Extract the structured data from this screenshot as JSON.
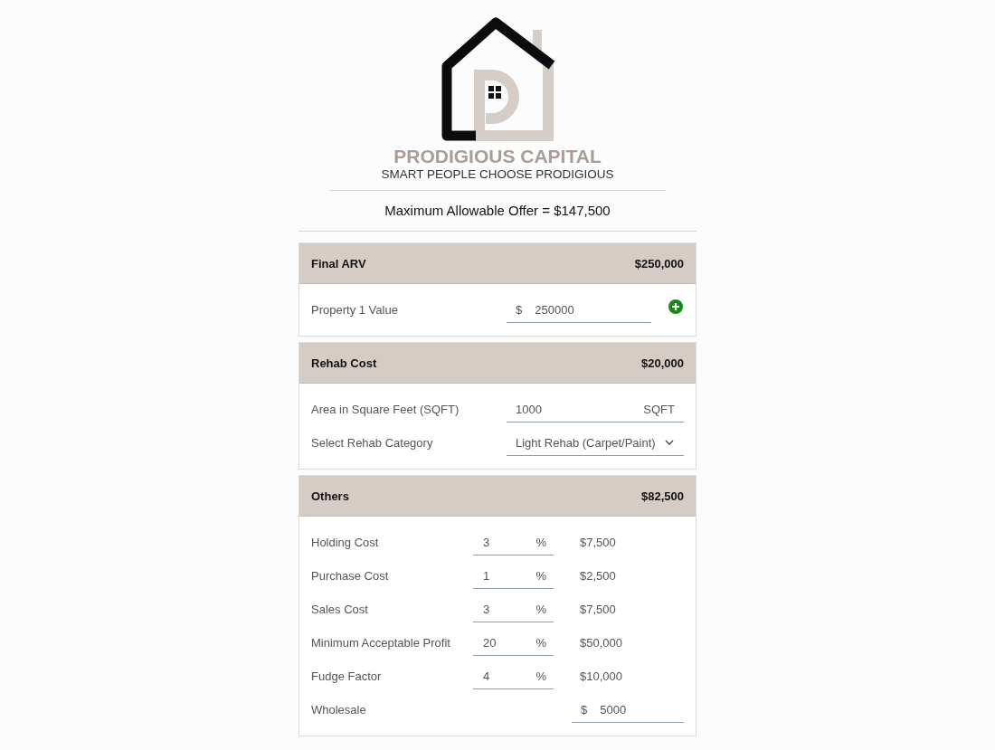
{
  "logo": {
    "company": "PRODIGIOUS CAPITAL",
    "tagline": "SMART PEOPLE CHOOSE PRODIGIOUS"
  },
  "summary": "Maximum Allowable Offer = $147,500",
  "sections": [
    {
      "title": "Final ARV",
      "total": "$250,000",
      "rows": [
        {
          "kind": "money_add",
          "label": "Property 1 Value",
          "prefix": "$",
          "value": "250000"
        }
      ]
    },
    {
      "title": "Rehab Cost",
      "total": "$20,000",
      "rows": [
        {
          "kind": "unit",
          "label": "Area in Square Feet (SQFT)",
          "value": "1000",
          "suffix": "SQFT"
        },
        {
          "kind": "select",
          "label": "Select Rehab Category",
          "value": "Light Rehab (Carpet/Paint)"
        }
      ]
    },
    {
      "title": "Others",
      "total": "$82,500",
      "rows": [
        {
          "kind": "percent",
          "label": "Holding Cost",
          "value": "3",
          "suffix": "%",
          "amount": "$7,500"
        },
        {
          "kind": "percent",
          "label": "Purchase Cost",
          "value": "1",
          "suffix": "%",
          "amount": "$2,500"
        },
        {
          "kind": "percent",
          "label": "Sales Cost",
          "value": "3",
          "suffix": "%",
          "amount": "$7,500"
        },
        {
          "kind": "percent",
          "label": "Minimum Acceptable Profit",
          "value": "20",
          "suffix": "%",
          "amount": "$50,000"
        },
        {
          "kind": "percent",
          "label": "Fudge Factor",
          "value": "4",
          "suffix": "%",
          "amount": "$10,000"
        },
        {
          "kind": "money",
          "label": "Wholesale",
          "prefix": "$",
          "value": "5000"
        }
      ]
    }
  ]
}
